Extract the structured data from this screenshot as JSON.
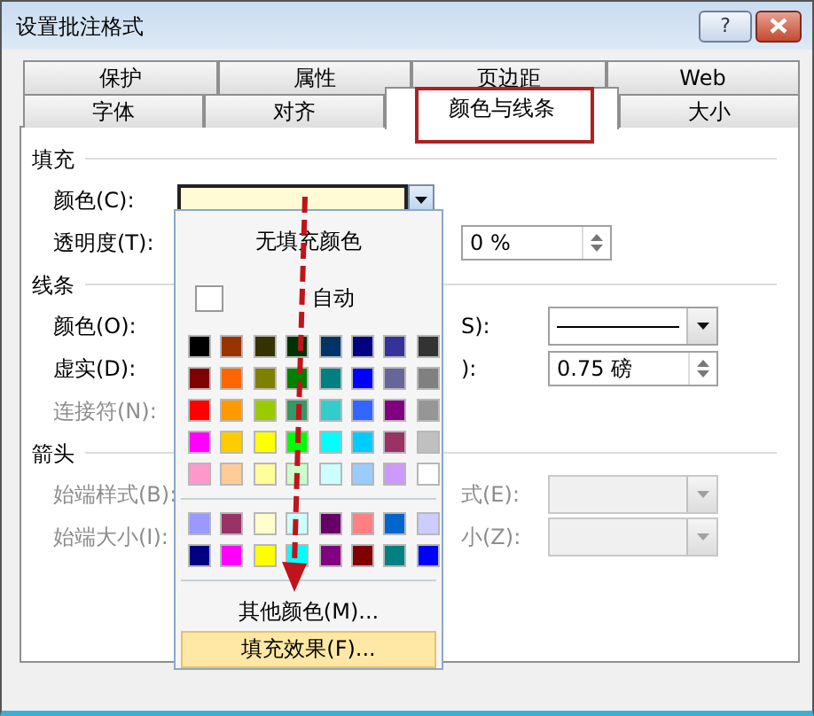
{
  "window": {
    "title": "设置批注格式",
    "help": "?"
  },
  "tabs": [
    [
      {
        "label": "保护",
        "selected": false
      },
      {
        "label": "属性",
        "selected": false
      },
      {
        "label": "页边距",
        "selected": false
      },
      {
        "label": "Web",
        "selected": false
      }
    ],
    [
      {
        "label": "字体",
        "selected": false
      },
      {
        "label": "对齐",
        "selected": false
      },
      {
        "label": "颜色与线条",
        "selected": true
      },
      {
        "label": "大小",
        "selected": false
      }
    ]
  ],
  "sections": [
    {
      "title": "填充",
      "rows": [
        {
          "label": "颜色(C):",
          "disabled": false,
          "control": {
            "kind": "color-combo"
          }
        },
        {
          "label": "透明度(T):",
          "disabled": false,
          "control": {
            "kind": "spin-wide",
            "value": "0 %",
            "disabled": false
          }
        }
      ]
    },
    {
      "title": "线条",
      "rows": [
        {
          "label": "颜色(O):",
          "disabled": false,
          "right_label": "S):",
          "control": {
            "kind": "line-combo",
            "disabled": false
          }
        },
        {
          "label": "虚实(D):",
          "disabled": false,
          "right_label": "):",
          "control": {
            "kind": "spin",
            "value": "0.75 磅",
            "disabled": false
          }
        },
        {
          "label": "连接符(N):",
          "disabled": true
        }
      ]
    },
    {
      "title": "箭头",
      "rows": [
        {
          "label": "始端样式(B):",
          "disabled": true,
          "right_label": "式(E):",
          "control": {
            "kind": "combo",
            "disabled": true
          }
        },
        {
          "label": "始端大小(I):",
          "disabled": true,
          "right_label": "小(Z):",
          "control": {
            "kind": "combo",
            "disabled": true
          }
        }
      ]
    }
  ],
  "color_menu": {
    "no_fill": "无填充颜色",
    "automatic": "自动",
    "palette": [
      [
        {
          "color": "#000000"
        },
        {
          "color": "#993300"
        },
        {
          "color": "#333300"
        },
        {
          "color": "#003300"
        },
        {
          "color": "#003366"
        },
        {
          "color": "#000080"
        },
        {
          "color": "#333399"
        },
        {
          "color": "#333333"
        }
      ],
      [
        {
          "color": "#800000"
        },
        {
          "color": "#ff6600"
        },
        {
          "color": "#808000"
        },
        {
          "color": "#008000"
        },
        {
          "color": "#008080"
        },
        {
          "color": "#0000ff"
        },
        {
          "color": "#666699"
        },
        {
          "color": "#808080"
        }
      ],
      [
        {
          "color": "#ff0000"
        },
        {
          "color": "#ff9900"
        },
        {
          "color": "#99cc00"
        },
        {
          "color": "#339966"
        },
        {
          "color": "#33cccc"
        },
        {
          "color": "#3366ff"
        },
        {
          "color": "#800080"
        },
        {
          "color": "#969696"
        }
      ],
      [
        {
          "color": "#ff00ff"
        },
        {
          "color": "#ffcc00"
        },
        {
          "color": "#ffff00"
        },
        {
          "color": "#00ff00"
        },
        {
          "color": "#00ffff"
        },
        {
          "color": "#00ccff"
        },
        {
          "color": "#993366"
        },
        {
          "color": "#c0c0c0"
        }
      ],
      [
        {
          "color": "#ff99cc"
        },
        {
          "color": "#ffcc99"
        },
        {
          "color": "#ffff99"
        },
        {
          "color": "#ccffcc"
        },
        {
          "color": "#ccffff"
        },
        {
          "color": "#99ccff"
        },
        {
          "color": "#cc99ff"
        },
        {
          "color": "#ffffff"
        }
      ]
    ],
    "chart_palette": [
      [
        {
          "color": "#9999ff"
        },
        {
          "color": "#993366"
        },
        {
          "color": "#ffffcc"
        },
        {
          "color": "#ccffff"
        },
        {
          "color": "#660066"
        },
        {
          "color": "#ff8080"
        },
        {
          "color": "#0066cc"
        },
        {
          "color": "#ccccff"
        }
      ],
      [
        {
          "color": "#000080"
        },
        {
          "color": "#ff00ff"
        },
        {
          "color": "#ffff00"
        },
        {
          "color": "#00ffff"
        },
        {
          "color": "#800080"
        },
        {
          "color": "#800000"
        },
        {
          "color": "#008080"
        },
        {
          "color": "#0000ff"
        }
      ]
    ],
    "items": [
      {
        "label": "其他颜色(M)...",
        "selected": false
      },
      {
        "label": "填充效果(F)...",
        "selected": true
      }
    ]
  },
  "highlight_frame": true,
  "arrow": true
}
